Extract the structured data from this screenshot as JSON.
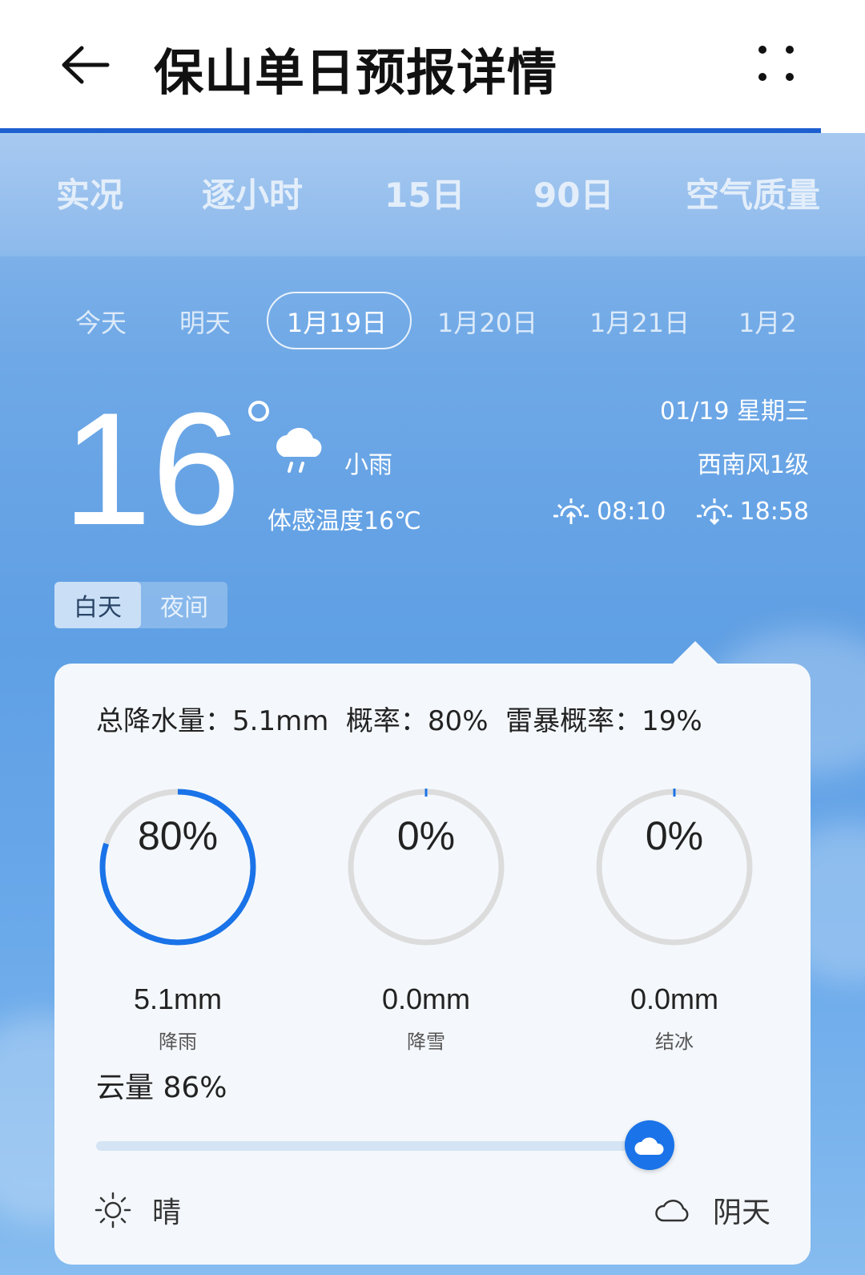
{
  "header": {
    "title": "保山单日预报详情"
  },
  "top_tabs": [
    "实况",
    "逐小时",
    "15日",
    "90日",
    "空气质量"
  ],
  "date_tabs": [
    {
      "label": "今天",
      "active": false
    },
    {
      "label": "明天",
      "active": false
    },
    {
      "label": "1月19日",
      "active": true
    },
    {
      "label": "1月20日",
      "active": false
    },
    {
      "label": "1月21日",
      "active": false
    },
    {
      "label": "1月2",
      "active": false
    }
  ],
  "current": {
    "temperature": "16",
    "condition": "小雨",
    "feels_like": "体感温度16℃",
    "date": "01/19 星期三",
    "wind": "西南风1级",
    "sunrise": "08:10",
    "sunset": "18:58",
    "condition_icon": "cloud-rain-icon"
  },
  "day_night": {
    "day": "白天",
    "night": "夜间",
    "active": "day"
  },
  "precip": {
    "summary": "总降水量：5.1mm  概率：80%  雷暴概率：19%",
    "rings": [
      {
        "percent_text": "80%",
        "percent": 80,
        "amount": "5.1mm",
        "label": "降雨"
      },
      {
        "percent_text": "0%",
        "percent": 0,
        "amount": "0.0mm",
        "label": "降雪"
      },
      {
        "percent_text": "0%",
        "percent": 0,
        "amount": "0.0mm",
        "label": "结冰"
      }
    ]
  },
  "cloud": {
    "label": "云量 86%",
    "percent": 86,
    "left_label": "晴",
    "right_label": "阴天"
  },
  "colors": {
    "accent": "#1a73e8",
    "ring_track": "#dcdcdc",
    "header_bar": "#1d5fcf"
  }
}
